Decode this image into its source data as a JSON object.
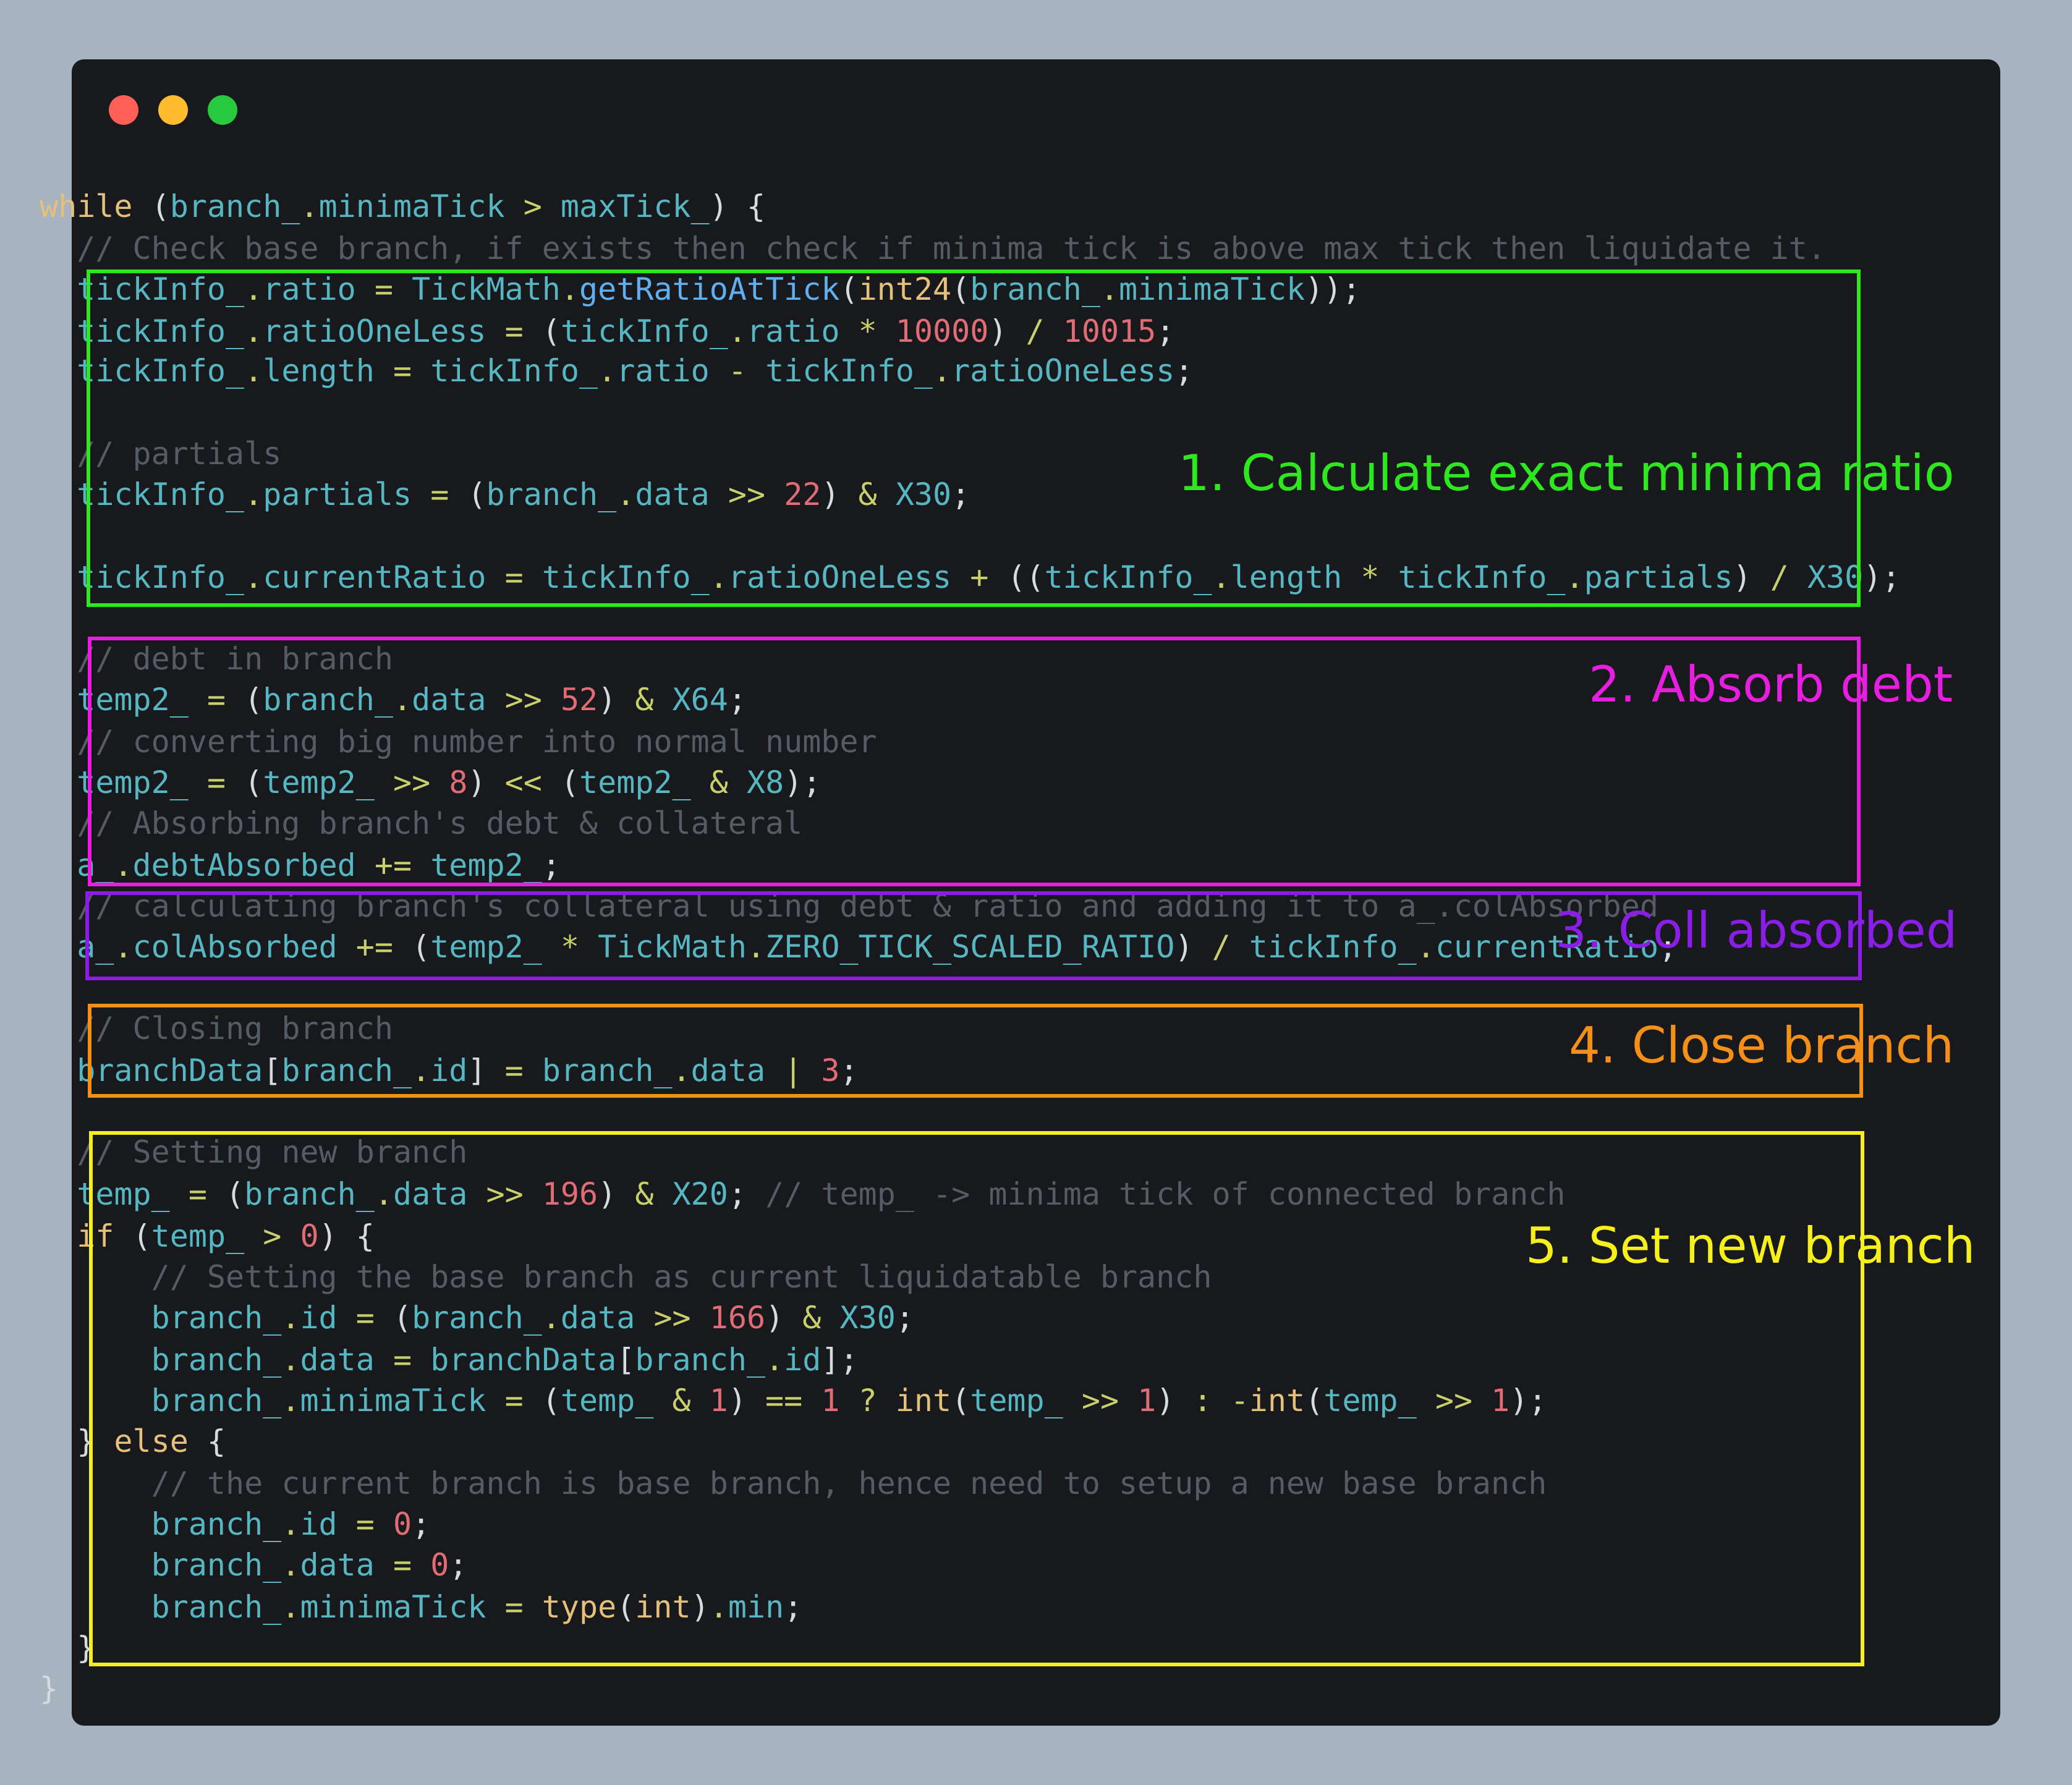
{
  "window": {
    "title_bar": {
      "buttons": [
        {
          "name": "close",
          "color": "#ff5f56"
        },
        {
          "name": "minimize",
          "color": "#ffbd2e"
        },
        {
          "name": "zoom",
          "color": "#27c93f"
        }
      ]
    }
  },
  "code": {
    "lines": [
      [
        [
          "kw",
          "while"
        ],
        [
          "p",
          " ("
        ],
        [
          "id",
          "branch_"
        ],
        [
          "op",
          "."
        ],
        [
          "id",
          "minimaTick"
        ],
        [
          "op",
          " > "
        ],
        [
          "id",
          "maxTick_"
        ],
        [
          "p",
          ") {"
        ]
      ],
      [
        [
          "cm",
          "  // Check base branch, if exists then check if minima tick is above max tick then liquidate it."
        ]
      ],
      [
        [
          "p",
          "  "
        ],
        [
          "id",
          "tickInfo_"
        ],
        [
          "op",
          "."
        ],
        [
          "id",
          "ratio"
        ],
        [
          "op",
          " = "
        ],
        [
          "id",
          "TickMath"
        ],
        [
          "op",
          "."
        ],
        [
          "fn",
          "getRatioAtTick"
        ],
        [
          "p",
          "("
        ],
        [
          "kw",
          "int24"
        ],
        [
          "p",
          "("
        ],
        [
          "id",
          "branch_"
        ],
        [
          "op",
          "."
        ],
        [
          "id",
          "minimaTick"
        ],
        [
          "p",
          "));"
        ]
      ],
      [
        [
          "p",
          "  "
        ],
        [
          "id",
          "tickInfo_"
        ],
        [
          "op",
          "."
        ],
        [
          "id",
          "ratioOneLess"
        ],
        [
          "op",
          " = "
        ],
        [
          "p",
          "("
        ],
        [
          "id",
          "tickInfo_"
        ],
        [
          "op",
          "."
        ],
        [
          "id",
          "ratio"
        ],
        [
          "op",
          " * "
        ],
        [
          "num",
          "10000"
        ],
        [
          "p",
          ")"
        ],
        [
          "op",
          " / "
        ],
        [
          "num",
          "10015"
        ],
        [
          "p",
          ";"
        ]
      ],
      [
        [
          "p",
          "  "
        ],
        [
          "id",
          "tickInfo_"
        ],
        [
          "op",
          "."
        ],
        [
          "id",
          "length"
        ],
        [
          "op",
          " = "
        ],
        [
          "id",
          "tickInfo_"
        ],
        [
          "op",
          "."
        ],
        [
          "id",
          "ratio"
        ],
        [
          "op",
          " - "
        ],
        [
          "id",
          "tickInfo_"
        ],
        [
          "op",
          "."
        ],
        [
          "id",
          "ratioOneLess"
        ],
        [
          "p",
          ";"
        ]
      ],
      [],
      [
        [
          "cm",
          "  // partials"
        ]
      ],
      [
        [
          "p",
          "  "
        ],
        [
          "id",
          "tickInfo_"
        ],
        [
          "op",
          "."
        ],
        [
          "id",
          "partials"
        ],
        [
          "op",
          " = "
        ],
        [
          "p",
          "("
        ],
        [
          "id",
          "branch_"
        ],
        [
          "op",
          "."
        ],
        [
          "id",
          "data"
        ],
        [
          "op",
          " >> "
        ],
        [
          "num",
          "22"
        ],
        [
          "p",
          ")"
        ],
        [
          "op",
          " & "
        ],
        [
          "id",
          "X30"
        ],
        [
          "p",
          ";"
        ]
      ],
      [],
      [
        [
          "p",
          "  "
        ],
        [
          "id",
          "tickInfo_"
        ],
        [
          "op",
          "."
        ],
        [
          "id",
          "currentRatio"
        ],
        [
          "op",
          " = "
        ],
        [
          "id",
          "tickInfo_"
        ],
        [
          "op",
          "."
        ],
        [
          "id",
          "ratioOneLess"
        ],
        [
          "op",
          " + "
        ],
        [
          "p",
          "(("
        ],
        [
          "id",
          "tickInfo_"
        ],
        [
          "op",
          "."
        ],
        [
          "id",
          "length"
        ],
        [
          "op",
          " * "
        ],
        [
          "id",
          "tickInfo_"
        ],
        [
          "op",
          "."
        ],
        [
          "id",
          "partials"
        ],
        [
          "p",
          ")"
        ],
        [
          "op",
          " / "
        ],
        [
          "id",
          "X30"
        ],
        [
          "p",
          ");"
        ]
      ],
      [],
      [
        [
          "cm",
          "  // debt in branch"
        ]
      ],
      [
        [
          "p",
          "  "
        ],
        [
          "id",
          "temp2_"
        ],
        [
          "op",
          " = "
        ],
        [
          "p",
          "("
        ],
        [
          "id",
          "branch_"
        ],
        [
          "op",
          "."
        ],
        [
          "id",
          "data"
        ],
        [
          "op",
          " >> "
        ],
        [
          "num",
          "52"
        ],
        [
          "p",
          ")"
        ],
        [
          "op",
          " & "
        ],
        [
          "id",
          "X64"
        ],
        [
          "p",
          ";"
        ]
      ],
      [
        [
          "cm",
          "  // converting big number into normal number"
        ]
      ],
      [
        [
          "p",
          "  "
        ],
        [
          "id",
          "temp2_"
        ],
        [
          "op",
          " = "
        ],
        [
          "p",
          "("
        ],
        [
          "id",
          "temp2_"
        ],
        [
          "op",
          " >> "
        ],
        [
          "num",
          "8"
        ],
        [
          "p",
          ")"
        ],
        [
          "op",
          " << "
        ],
        [
          "p",
          "("
        ],
        [
          "id",
          "temp2_"
        ],
        [
          "op",
          " & "
        ],
        [
          "id",
          "X8"
        ],
        [
          "p",
          ");"
        ]
      ],
      [
        [
          "cm",
          "  // Absorbing branch's debt & collateral"
        ]
      ],
      [
        [
          "p",
          "  "
        ],
        [
          "id",
          "a_"
        ],
        [
          "op",
          "."
        ],
        [
          "id",
          "debtAbsorbed"
        ],
        [
          "op",
          " += "
        ],
        [
          "id",
          "temp2_"
        ],
        [
          "p",
          ";"
        ]
      ],
      [
        [
          "cm",
          "  // calculating branch's collateral using debt & ratio and adding it to a_.colAbsorbed"
        ]
      ],
      [
        [
          "p",
          "  "
        ],
        [
          "id",
          "a_"
        ],
        [
          "op",
          "."
        ],
        [
          "id",
          "colAbsorbed"
        ],
        [
          "op",
          " += "
        ],
        [
          "p",
          "("
        ],
        [
          "id",
          "temp2_"
        ],
        [
          "op",
          " * "
        ],
        [
          "id",
          "TickMath"
        ],
        [
          "op",
          "."
        ],
        [
          "id",
          "ZERO_TICK_SCALED_RATIO"
        ],
        [
          "p",
          ")"
        ],
        [
          "op",
          " / "
        ],
        [
          "id",
          "tickInfo_"
        ],
        [
          "op",
          "."
        ],
        [
          "id",
          "currentRatio"
        ],
        [
          "p",
          ";"
        ]
      ],
      [],
      [
        [
          "cm",
          "  // Closing branch"
        ]
      ],
      [
        [
          "p",
          "  "
        ],
        [
          "id",
          "branchData"
        ],
        [
          "p",
          "["
        ],
        [
          "id",
          "branch_"
        ],
        [
          "op",
          "."
        ],
        [
          "id",
          "id"
        ],
        [
          "p",
          "]"
        ],
        [
          "op",
          " = "
        ],
        [
          "id",
          "branch_"
        ],
        [
          "op",
          "."
        ],
        [
          "id",
          "data"
        ],
        [
          "op",
          " | "
        ],
        [
          "num",
          "3"
        ],
        [
          "p",
          ";"
        ]
      ],
      [],
      [
        [
          "cm",
          "  // Setting new branch"
        ]
      ],
      [
        [
          "p",
          "  "
        ],
        [
          "id",
          "temp_"
        ],
        [
          "op",
          " = "
        ],
        [
          "p",
          "("
        ],
        [
          "id",
          "branch_"
        ],
        [
          "op",
          "."
        ],
        [
          "id",
          "data"
        ],
        [
          "op",
          " >> "
        ],
        [
          "num",
          "196"
        ],
        [
          "p",
          ")"
        ],
        [
          "op",
          " & "
        ],
        [
          "id",
          "X20"
        ],
        [
          "p",
          "; "
        ],
        [
          "cm",
          "// temp_ -> minima tick of connected branch"
        ]
      ],
      [
        [
          "p",
          "  "
        ],
        [
          "kw",
          "if"
        ],
        [
          "p",
          " ("
        ],
        [
          "id",
          "temp_"
        ],
        [
          "op",
          " > "
        ],
        [
          "num",
          "0"
        ],
        [
          "p",
          ") {"
        ]
      ],
      [
        [
          "cm",
          "      // Setting the base branch as current liquidatable branch"
        ]
      ],
      [
        [
          "p",
          "      "
        ],
        [
          "id",
          "branch_"
        ],
        [
          "op",
          "."
        ],
        [
          "id",
          "id"
        ],
        [
          "op",
          " = "
        ],
        [
          "p",
          "("
        ],
        [
          "id",
          "branch_"
        ],
        [
          "op",
          "."
        ],
        [
          "id",
          "data"
        ],
        [
          "op",
          " >> "
        ],
        [
          "num",
          "166"
        ],
        [
          "p",
          ")"
        ],
        [
          "op",
          " & "
        ],
        [
          "id",
          "X30"
        ],
        [
          "p",
          ";"
        ]
      ],
      [
        [
          "p",
          "      "
        ],
        [
          "id",
          "branch_"
        ],
        [
          "op",
          "."
        ],
        [
          "id",
          "data"
        ],
        [
          "op",
          " = "
        ],
        [
          "id",
          "branchData"
        ],
        [
          "p",
          "["
        ],
        [
          "id",
          "branch_"
        ],
        [
          "op",
          "."
        ],
        [
          "id",
          "id"
        ],
        [
          "p",
          "];"
        ]
      ],
      [
        [
          "p",
          "      "
        ],
        [
          "id",
          "branch_"
        ],
        [
          "op",
          "."
        ],
        [
          "id",
          "minimaTick"
        ],
        [
          "op",
          " = "
        ],
        [
          "p",
          "("
        ],
        [
          "id",
          "temp_"
        ],
        [
          "op",
          " & "
        ],
        [
          "num",
          "1"
        ],
        [
          "p",
          ")"
        ],
        [
          "op",
          " == "
        ],
        [
          "num",
          "1"
        ],
        [
          "op",
          " ? "
        ],
        [
          "kw",
          "int"
        ],
        [
          "p",
          "("
        ],
        [
          "id",
          "temp_"
        ],
        [
          "op",
          " >> "
        ],
        [
          "num",
          "1"
        ],
        [
          "p",
          ")"
        ],
        [
          "op",
          " : -"
        ],
        [
          "kw",
          "int"
        ],
        [
          "p",
          "("
        ],
        [
          "id",
          "temp_"
        ],
        [
          "op",
          " >> "
        ],
        [
          "num",
          "1"
        ],
        [
          "p",
          ");"
        ]
      ],
      [
        [
          "p",
          "  } "
        ],
        [
          "kw",
          "else"
        ],
        [
          "p",
          " {"
        ]
      ],
      [
        [
          "cm",
          "      // the current branch is base branch, hence need to setup a new base branch"
        ]
      ],
      [
        [
          "p",
          "      "
        ],
        [
          "id",
          "branch_"
        ],
        [
          "op",
          "."
        ],
        [
          "id",
          "id"
        ],
        [
          "op",
          " = "
        ],
        [
          "num",
          "0"
        ],
        [
          "p",
          ";"
        ]
      ],
      [
        [
          "p",
          "      "
        ],
        [
          "id",
          "branch_"
        ],
        [
          "op",
          "."
        ],
        [
          "id",
          "data"
        ],
        [
          "op",
          " = "
        ],
        [
          "num",
          "0"
        ],
        [
          "p",
          ";"
        ]
      ],
      [
        [
          "p",
          "      "
        ],
        [
          "id",
          "branch_"
        ],
        [
          "op",
          "."
        ],
        [
          "id",
          "minimaTick"
        ],
        [
          "op",
          " = "
        ],
        [
          "kw",
          "type"
        ],
        [
          "p",
          "("
        ],
        [
          "kw",
          "int"
        ],
        [
          "p",
          ")"
        ],
        [
          "op",
          "."
        ],
        [
          "id",
          "min"
        ],
        [
          "p",
          ";"
        ]
      ],
      [
        [
          "p",
          "  }"
        ]
      ],
      [
        [
          "p",
          "}"
        ]
      ]
    ]
  },
  "annotations": [
    {
      "label": "1. Calculate exact minima ratio",
      "color": "#2ee81f"
    },
    {
      "label": "2. Absorb debt",
      "color": "#e61ee0"
    },
    {
      "label": "3. Coll absorbed",
      "color": "#8a1ee6"
    },
    {
      "label": "4. Close branch",
      "color": "#f2901a"
    },
    {
      "label": "5. Set new branch",
      "color": "#f5ef1c"
    }
  ]
}
